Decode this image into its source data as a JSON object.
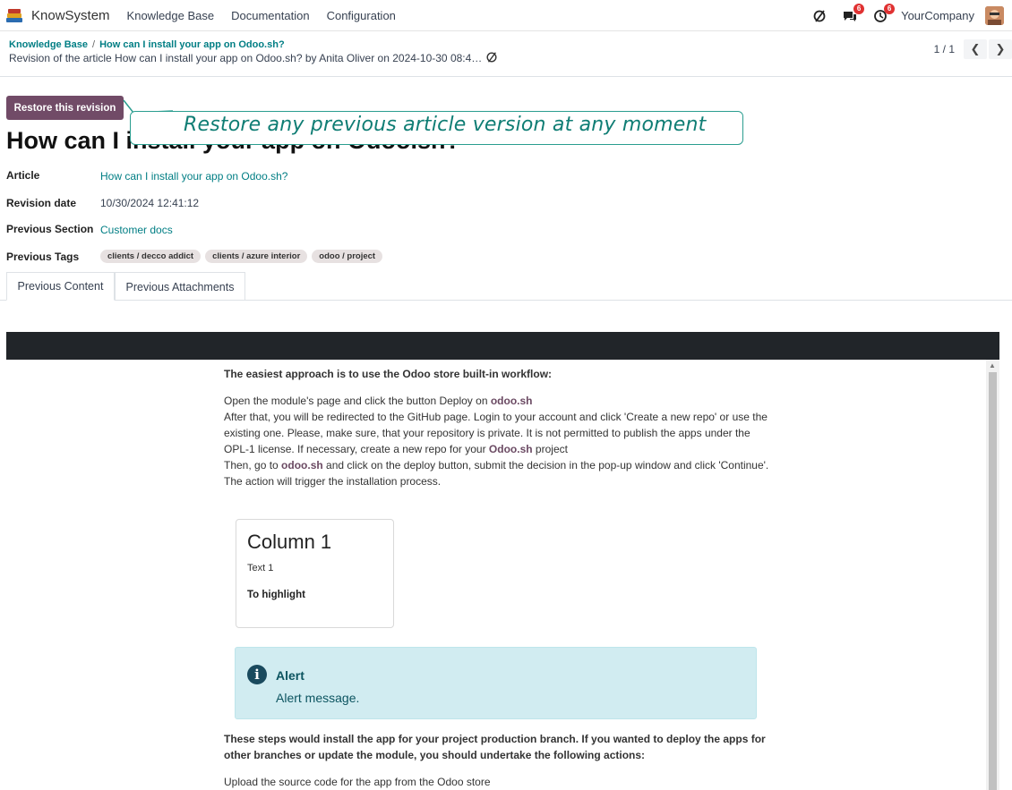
{
  "navbar": {
    "app_name": "KnowSystem",
    "menus": [
      "Knowledge Base",
      "Documentation",
      "Configuration"
    ],
    "messages_badge": "6",
    "activities_badge": "6",
    "company": "YourCompany"
  },
  "control_panel": {
    "breadcrumb_root": "Knowledge Base",
    "breadcrumb_current": "How can I install your app on Odoo.sh?",
    "record_title": "Revision of the article How can I install your app on Odoo.sh? by Anita Oliver on 2024-10-30 08:4…",
    "pager_value": "1 / 1"
  },
  "form": {
    "restore_button": "Restore this revision",
    "title": "How can I install your app on Odoo.sh?",
    "callout": "Restore any previous article version at any moment",
    "fields": {
      "article_label": "Article",
      "article_value": "How can I install your app on Odoo.sh?",
      "revision_date_label": "Revision date",
      "revision_date_value": "10/30/2024 12:41:12",
      "prev_section_label": "Previous Section",
      "prev_section_value": "Customer docs",
      "prev_tags_label": "Previous Tags"
    },
    "tags": [
      "clients / decco addict",
      "clients / azure interior",
      "odoo / project"
    ],
    "tabs": [
      "Previous Content",
      "Previous Attachments"
    ]
  },
  "content": {
    "heading": "The easiest approach is to use the Odoo store built-in workflow:",
    "p1_pre": "Open the module's page and click the button Deploy on ",
    "odoo_sh": "odoo.sh",
    "p2": "After that, you will be redirected to the GitHub page. Login to your account and click 'Create a new repo' or use the existing one. Please, make sure, that your repository is private. It is not permitted to publish the apps under the OPL-1 license. If necessary, create a new repo for your ",
    "odoo_sh_cap": "Odoo.sh",
    "p2_post": " project",
    "p3_pre": "Then, go to ",
    "p3_post": " and click on the deploy button, submit the decision in the pop-up window and click 'Continue'. The action will trigger the installation process.",
    "card_title": "Column 1",
    "card_text": "Text 1",
    "card_bold": "To highlight",
    "alert_title": "Alert",
    "alert_message": "Alert message.",
    "steps_heading": "These steps would install the app for your project production branch. If you wanted to deploy the apps for other branches or update the module, you should undertake the following actions:",
    "last_line": "Upload the source code for the app from the Odoo store"
  }
}
